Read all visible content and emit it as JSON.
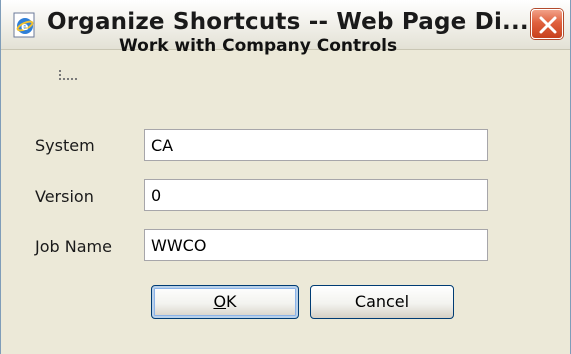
{
  "window": {
    "title": "Organize Shortcuts -- Web Page Di...",
    "icon": "ie-page-icon",
    "close_icon": "close-icon"
  },
  "form": {
    "header_icon": "tree-icon",
    "title": "Work with Company Controls",
    "fields": [
      {
        "label": "System",
        "value": "CA"
      },
      {
        "label": "Version",
        "value": "0"
      },
      {
        "label": "Job Name",
        "value": "WWCO"
      }
    ]
  },
  "buttons": {
    "ok_label": "OK",
    "cancel_label": "Cancel"
  },
  "colors": {
    "close_button": "#e0613e",
    "dialog_background": "#ece9d8",
    "ok_focus_ring": "#8cb3e8"
  }
}
